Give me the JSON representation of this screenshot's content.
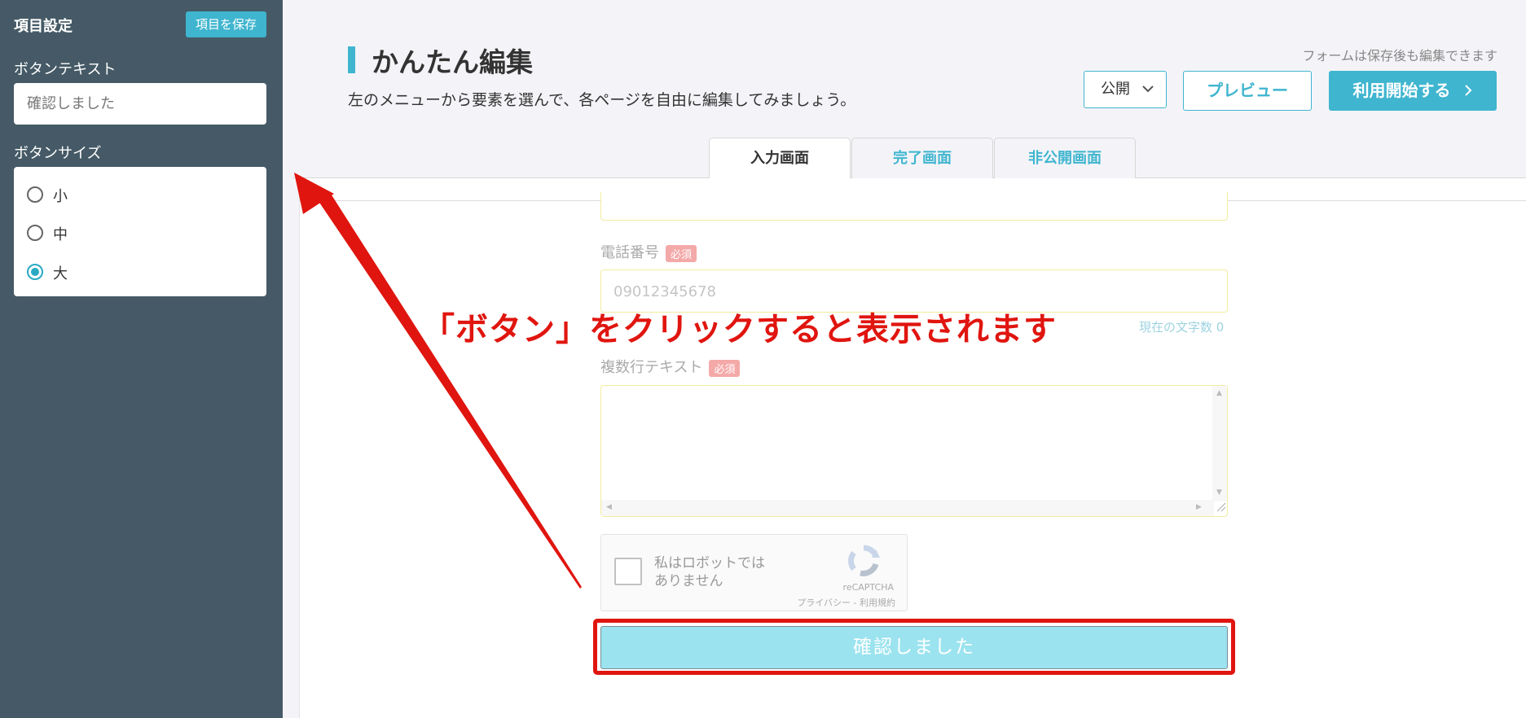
{
  "sidebar": {
    "title": "項目設定",
    "save_button": "項目を保存",
    "button_text_label": "ボタンテキスト",
    "button_text_value": "確認しました",
    "button_size_label": "ボタンサイズ",
    "sizes": [
      {
        "label": "小",
        "selected": false
      },
      {
        "label": "中",
        "selected": false
      },
      {
        "label": "大",
        "selected": true
      }
    ]
  },
  "header": {
    "title": "かんたん編集",
    "subtitle": "左のメニューから要素を選んで、各ページを自由に編集してみましょう。",
    "note": "フォームは保存後も編集できます",
    "publish_select": "公開",
    "preview_button": "プレビュー",
    "start_button": "利用開始する"
  },
  "tabs": [
    {
      "label": "入力画面",
      "active": true
    },
    {
      "label": "完了画面",
      "active": false
    },
    {
      "label": "非公開画面",
      "active": false
    }
  ],
  "form": {
    "phone_label": "電話番号",
    "required_badge": "必須",
    "phone_placeholder": "09012345678",
    "char_count": "現在の文字数 0",
    "multiline_label": "複数行テキスト",
    "recaptcha_text": "私はロボットではありません",
    "recaptcha_brand": "reCAPTCHA",
    "recaptcha_links": "プライバシー - 利用規約",
    "confirm_button": "確認しました"
  },
  "annotation": {
    "text": "「ボタン」をクリックすると表示されます",
    "color": "#e0150f"
  },
  "colors": {
    "accent": "#3fb5cf",
    "sidebar_bg": "#455a66",
    "confirm_bg": "#9be3ef"
  }
}
